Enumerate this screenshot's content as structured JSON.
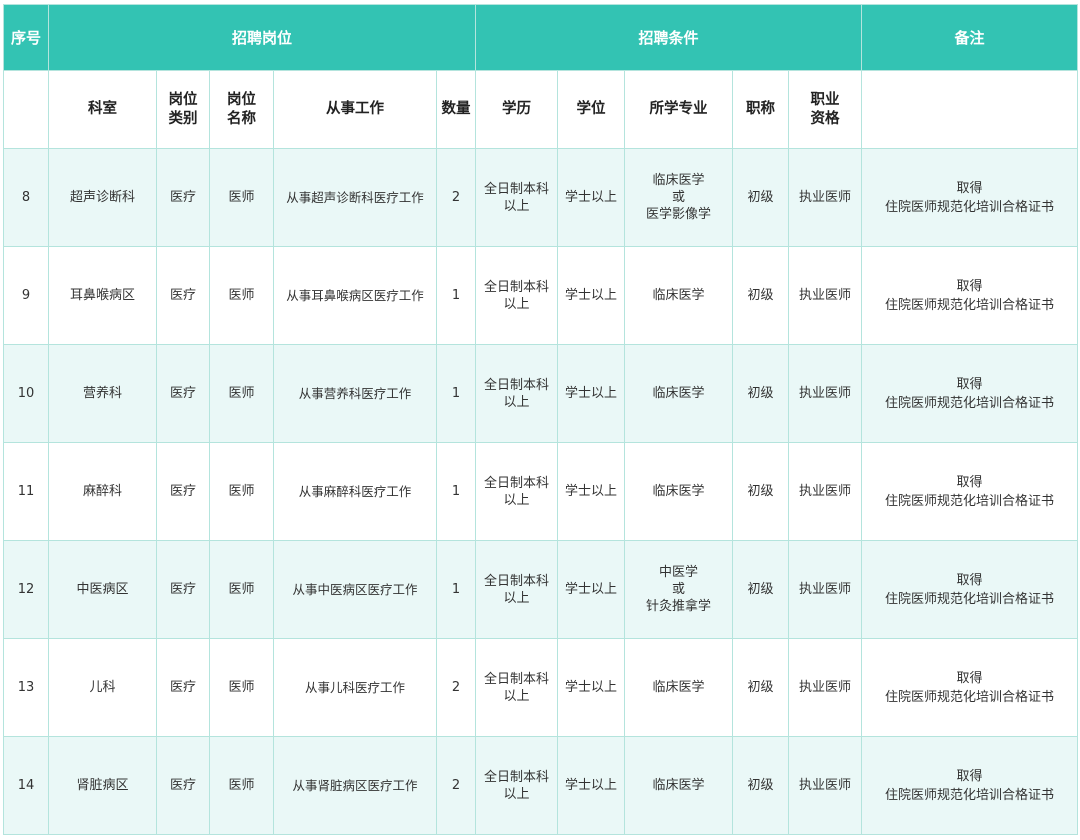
{
  "header_band": {
    "seq": "序号",
    "position_group": "招聘岗位",
    "conditions_group": "招聘条件",
    "remarks": "备注"
  },
  "columns": {
    "dept": "科室",
    "category": [
      "岗位",
      "类别"
    ],
    "post_name": [
      "岗位",
      "名称"
    ],
    "work": "从事工作",
    "count": "数量",
    "education": "学历",
    "degree": "学位",
    "major": "所学专业",
    "title": "职称",
    "qualification": [
      "职业",
      "资格"
    ]
  },
  "rows": [
    {
      "seq": "8",
      "dept": "超声诊断科",
      "category": "医疗",
      "post": "医师",
      "work": "从事超声诊断科医疗工作",
      "count": "2",
      "education": [
        "全日制本科",
        "以上"
      ],
      "degree": "学士以上",
      "major": [
        "临床医学",
        "或",
        "医学影像学"
      ],
      "title": "初级",
      "qualification": "执业医师",
      "note": [
        "取得",
        "住院医师规范化培训合格证书"
      ]
    },
    {
      "seq": "9",
      "dept": "耳鼻喉病区",
      "category": "医疗",
      "post": "医师",
      "work": "从事耳鼻喉病区医疗工作",
      "count": "1",
      "education": [
        "全日制本科",
        "以上"
      ],
      "degree": "学士以上",
      "major": [
        "临床医学"
      ],
      "title": "初级",
      "qualification": "执业医师",
      "note": [
        "取得",
        "住院医师规范化培训合格证书"
      ]
    },
    {
      "seq": "10",
      "dept": "营养科",
      "category": "医疗",
      "post": "医师",
      "work": "从事营养科医疗工作",
      "count": "1",
      "education": [
        "全日制本科",
        "以上"
      ],
      "degree": "学士以上",
      "major": [
        "临床医学"
      ],
      "title": "初级",
      "qualification": "执业医师",
      "note": [
        "取得",
        "住院医师规范化培训合格证书"
      ]
    },
    {
      "seq": "11",
      "dept": "麻醉科",
      "category": "医疗",
      "post": "医师",
      "work": "从事麻醉科医疗工作",
      "count": "1",
      "education": [
        "全日制本科",
        "以上"
      ],
      "degree": "学士以上",
      "major": [
        "临床医学"
      ],
      "title": "初级",
      "qualification": "执业医师",
      "note": [
        "取得",
        "住院医师规范化培训合格证书"
      ]
    },
    {
      "seq": "12",
      "dept": "中医病区",
      "category": "医疗",
      "post": "医师",
      "work": "从事中医病区医疗工作",
      "count": "1",
      "education": [
        "全日制本科",
        "以上"
      ],
      "degree": "学士以上",
      "major": [
        "中医学",
        "或",
        "针灸推拿学"
      ],
      "title": "初级",
      "qualification": "执业医师",
      "note": [
        "取得",
        "住院医师规范化培训合格证书"
      ]
    },
    {
      "seq": "13",
      "dept": "儿科",
      "category": "医疗",
      "post": "医师",
      "work": "从事儿科医疗工作",
      "count": "2",
      "education": [
        "全日制本科",
        "以上"
      ],
      "degree": "学士以上",
      "major": [
        "临床医学"
      ],
      "title": "初级",
      "qualification": "执业医师",
      "note": [
        "取得",
        "住院医师规范化培训合格证书"
      ]
    },
    {
      "seq": "14",
      "dept": "肾脏病区",
      "category": "医疗",
      "post": "医师",
      "work": "从事肾脏病区医疗工作",
      "count": "2",
      "education": [
        "全日制本科",
        "以上"
      ],
      "degree": "学士以上",
      "major": [
        "临床医学"
      ],
      "title": "初级",
      "qualification": "执业医师",
      "note": [
        "取得",
        "住院医师规范化培训合格证书"
      ]
    }
  ],
  "colors": {
    "header_band": "#33c3b3",
    "stripe": "#eaf8f7",
    "grid_line": "#b4e4dd"
  }
}
